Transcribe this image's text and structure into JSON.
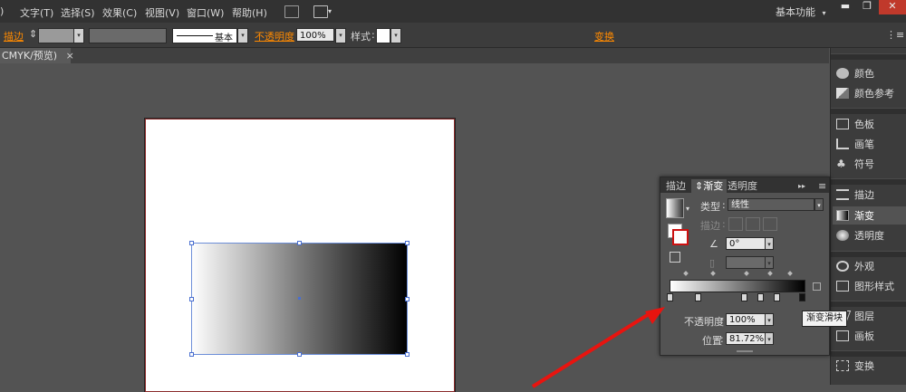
{
  "menu": {
    "items": [
      ")",
      "文字(T)",
      "选择(S)",
      "效果(C)",
      "视图(V)",
      "窗口(W)",
      "帮助(H)"
    ],
    "workspace": "基本功能",
    "workspace_arrow": "▾",
    "win_min": "▬",
    "win_max": "❐",
    "win_close": "✕"
  },
  "control_bar": {
    "stroke_label": "描边",
    "stroke_spinner": "⇕",
    "brush_label": "基本",
    "opacity_label": "不透明度",
    "opacity_value": "100%",
    "style_label": "样式",
    "transform_label": "变换",
    "menu_icon": "⋮≡"
  },
  "document_tab": {
    "label": "CMYK/预览)",
    "close": "×"
  },
  "dock": {
    "items": [
      {
        "label": "颜色",
        "icon": "palette-icon"
      },
      {
        "label": "颜色参考",
        "icon": "color-guide-icon"
      },
      {
        "label": "色板",
        "icon": "swatches-icon"
      },
      {
        "label": "画笔",
        "icon": "brush-icon"
      },
      {
        "label": "符号",
        "icon": "symbol-icon"
      },
      {
        "label": "描边",
        "icon": "stroke-icon"
      },
      {
        "label": "渐变",
        "icon": "gradient-icon"
      },
      {
        "label": "透明度",
        "icon": "transparency-icon"
      },
      {
        "label": "外观",
        "icon": "appearance-icon"
      },
      {
        "label": "图形样式",
        "icon": "graphic-styles-icon"
      },
      {
        "label": "图层",
        "icon": "layers-icon"
      },
      {
        "label": "画板",
        "icon": "artboards-icon"
      },
      {
        "label": "变换",
        "icon": "transform-icon"
      }
    ]
  },
  "gradient_panel": {
    "tabs": [
      "描边",
      "渐变",
      "透明度"
    ],
    "active_tab": "渐变",
    "tab_arrows": "▸▸",
    "tab_menu": "≡",
    "type_label": "类型",
    "type_value": "线性",
    "stroke_label": "描边",
    "angle_value": "0°",
    "opacity_label": "不透明度",
    "opacity_value": "100%",
    "location_label": "位置",
    "location_value": "81.72%",
    "dropdown_arrow": "▾"
  },
  "tooltip": {
    "text": "渐变滑块"
  },
  "colors": {
    "accent_orange": "#ff8a00",
    "arrow_red": "#e8140f",
    "selection_blue": "#4a6fd0"
  }
}
